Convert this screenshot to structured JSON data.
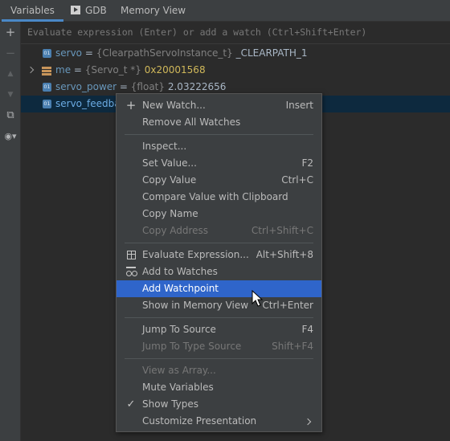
{
  "tabs": [
    {
      "label": "Variables",
      "icon": "none"
    },
    {
      "label": "GDB",
      "icon": "console-icon"
    },
    {
      "label": "Memory View",
      "icon": "none"
    }
  ],
  "toolbar": {
    "add": "+",
    "remove": "−",
    "up": "▲",
    "down": "▼",
    "copy": "⧉",
    "view": "◉▾"
  },
  "eval": {
    "placeholder": "Evaluate expression (Enter) or add a watch (Ctrl+Shift+Enter)"
  },
  "variables": [
    {
      "badge": "01",
      "name": "servo",
      "type": "{ClearpathServoInstance_t}",
      "value": "_CLEARPATH_1"
    },
    {
      "badge": "obj",
      "name": "me",
      "type": "{Servo_t *}",
      "value": "0x20001568"
    },
    {
      "badge": "01",
      "name": "servo_power",
      "type": "{float}",
      "value": "2.03222656"
    },
    {
      "badge": "01",
      "name": "servo_feedba",
      "type": "",
      "value": ""
    }
  ],
  "menu": [
    {
      "label": "New Watch...",
      "shortcut": "Insert",
      "lead": "+",
      "state": "normal"
    },
    {
      "label": "Remove All Watches",
      "shortcut": "",
      "state": "normal"
    },
    {
      "label": "Inspect...",
      "shortcut": "",
      "state": "normal"
    },
    {
      "label": "Set Value...",
      "shortcut": "F2",
      "state": "normal"
    },
    {
      "label": "Copy Value",
      "shortcut": "Ctrl+C",
      "state": "normal"
    },
    {
      "label": "Compare Value with Clipboard",
      "shortcut": "",
      "state": "normal"
    },
    {
      "label": "Copy Name",
      "shortcut": "",
      "state": "normal"
    },
    {
      "label": "Copy Address",
      "shortcut": "Ctrl+Shift+C",
      "state": "disabled"
    },
    {
      "label": "Evaluate Expression...",
      "shortcut": "Alt+Shift+8",
      "state": "normal"
    },
    {
      "label": "Add to Watches",
      "shortcut": "",
      "state": "normal"
    },
    {
      "label": "Add Watchpoint",
      "shortcut": "",
      "state": "highlighted"
    },
    {
      "label": "Show in Memory View",
      "shortcut": "Ctrl+Enter",
      "state": "normal"
    },
    {
      "label": "Jump To Source",
      "shortcut": "F4",
      "state": "normal"
    },
    {
      "label": "Jump To Type Source",
      "shortcut": "Shift+F4",
      "state": "disabled"
    },
    {
      "label": "View as Array...",
      "shortcut": "",
      "state": "disabled"
    },
    {
      "label": "Mute Variables",
      "shortcut": "",
      "state": "normal"
    },
    {
      "label": "Show Types",
      "shortcut": "",
      "lead": "✓",
      "state": "checked"
    },
    {
      "label": "Customize Presentation",
      "shortcut": "",
      "state": "submenu"
    }
  ],
  "colors": {
    "highlight": "#2f65ca",
    "selection_row": "#0d293e",
    "tab_underline": "#4a88c7"
  }
}
